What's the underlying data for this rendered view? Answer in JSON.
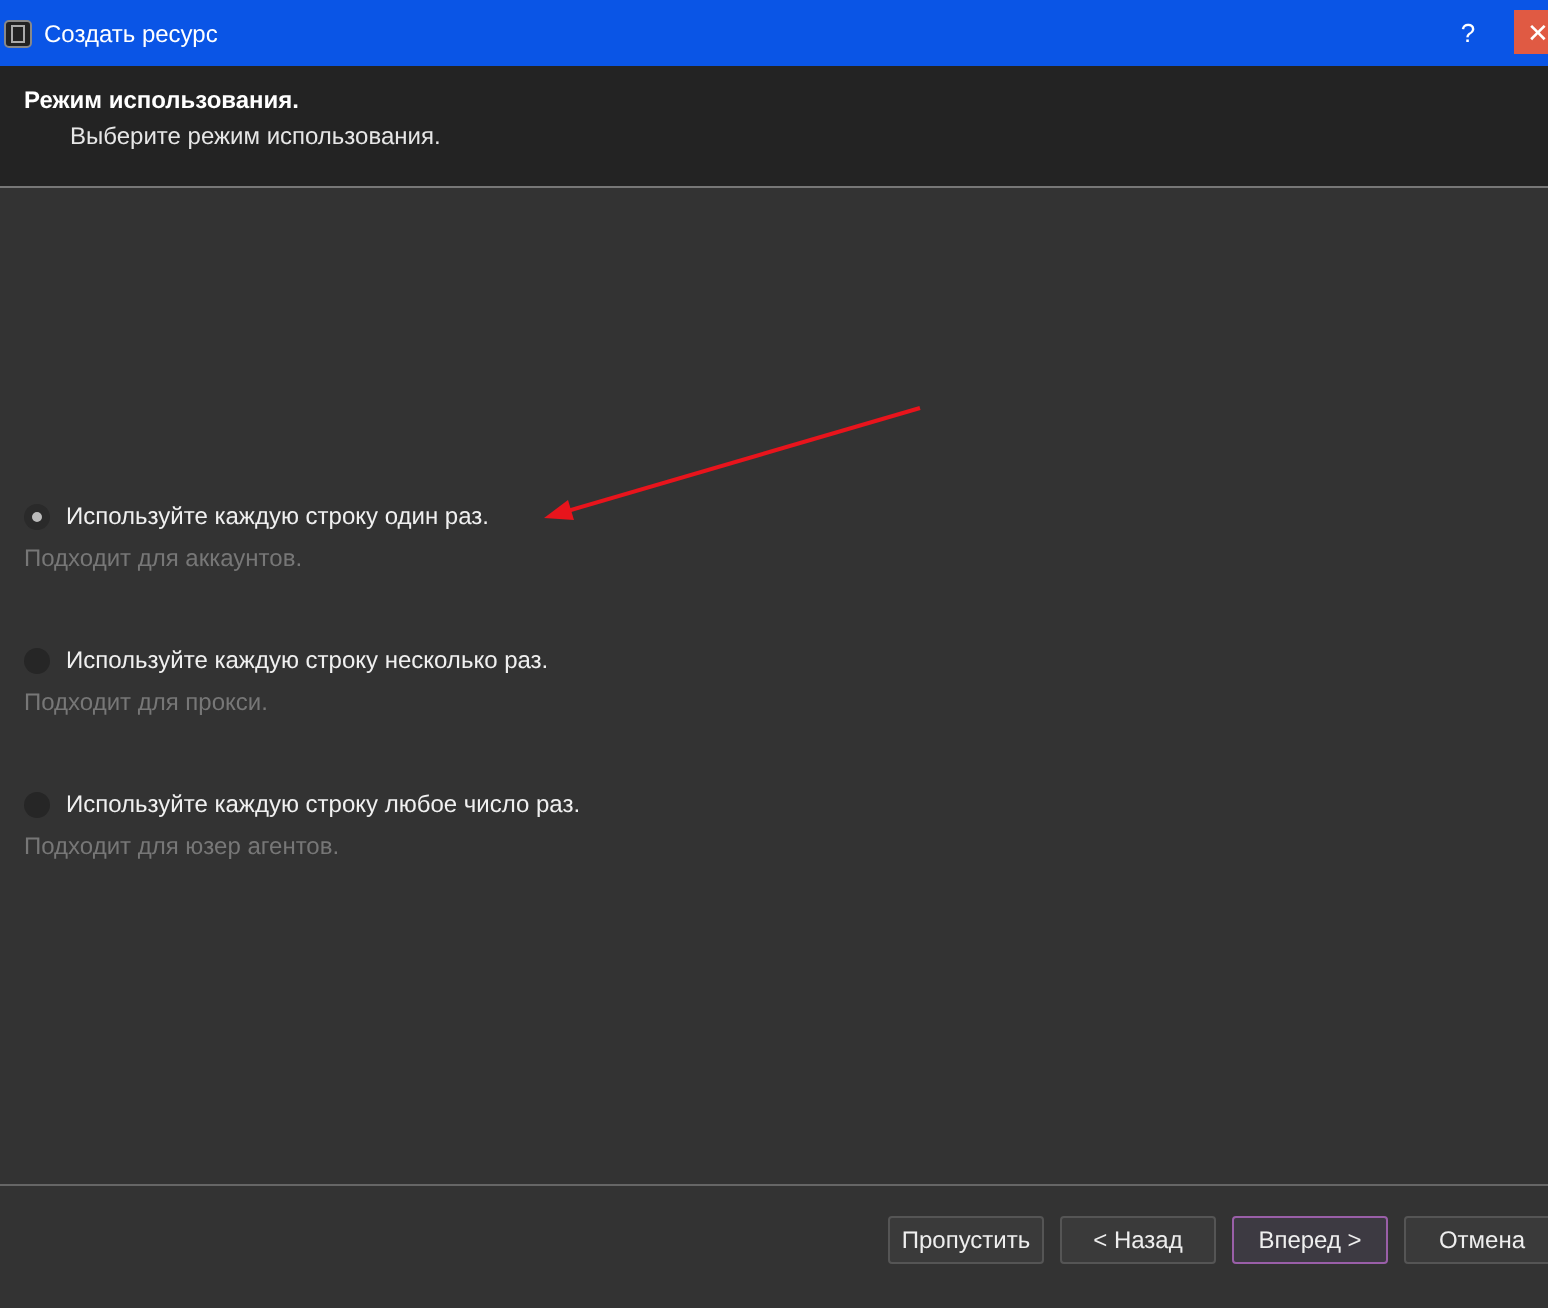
{
  "window": {
    "title": "Создать ресурс",
    "help": "?",
    "close": "✕"
  },
  "header": {
    "title": "Режим использования.",
    "subtitle": "Выберите режим использования."
  },
  "options": [
    {
      "label": "Используйте каждую строку один раз.",
      "hint": "Подходит для аккаунтов.",
      "selected": true
    },
    {
      "label": "Используйте каждую строку несколько раз.",
      "hint": "Подходит для прокси.",
      "selected": false
    },
    {
      "label": "Используйте каждую строку любое число раз.",
      "hint": "Подходит для юзер агентов.",
      "selected": false
    }
  ],
  "buttons": [
    {
      "label": "Пропустить",
      "default": false
    },
    {
      "label": "< Назад",
      "default": false
    },
    {
      "label": "Вперед >",
      "default": true
    },
    {
      "label": "Отмена",
      "default": false
    }
  ]
}
